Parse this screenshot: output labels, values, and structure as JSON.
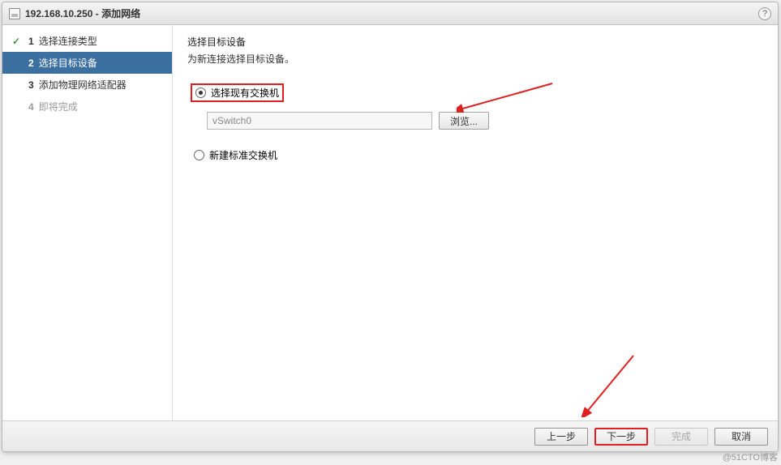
{
  "titlebar": {
    "host": "192.168.10.250",
    "action": "添加网络"
  },
  "sidebar": {
    "steps": [
      {
        "num": "1",
        "label": "选择连接类型",
        "state": "completed"
      },
      {
        "num": "2",
        "label": "选择目标设备",
        "state": "active"
      },
      {
        "num": "3",
        "label": "添加物理网络适配器",
        "state": "normal"
      },
      {
        "num": "4",
        "label": "即将完成",
        "state": "disabled"
      }
    ]
  },
  "main": {
    "title": "选择目标设备",
    "desc": "为新连接选择目标设备。",
    "options": {
      "existing": {
        "label": "选择现有交换机",
        "selected": true
      },
      "new": {
        "label": "新建标准交换机",
        "selected": false
      }
    },
    "switch_input": {
      "value": "vSwitch0"
    },
    "browse_label": "浏览..."
  },
  "footer": {
    "back": "上一步",
    "next": "下一步",
    "finish": "完成",
    "cancel": "取消"
  },
  "watermark": "@51CTO博客",
  "colors": {
    "highlight_border": "#e02020",
    "step_active_bg": "#3b6fa0",
    "check_green": "#3a9b3a"
  }
}
